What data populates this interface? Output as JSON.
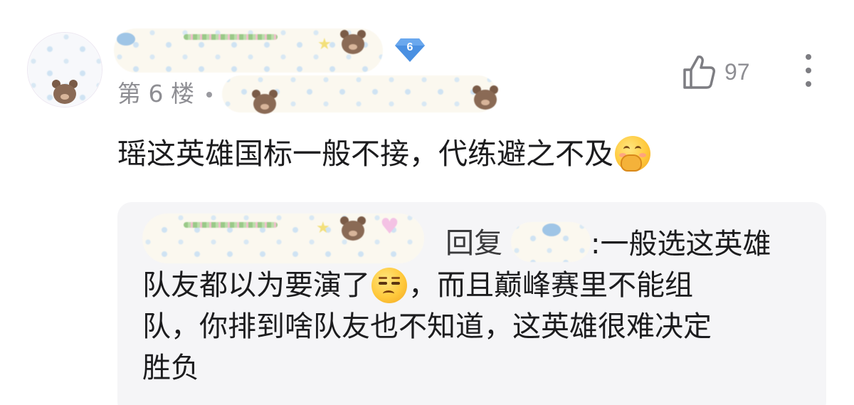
{
  "comment": {
    "floor_label": "第 6 楼",
    "separator": "•",
    "level": "6",
    "likes": "97",
    "text": "瑶这英雄国标一般不接，代练避之不及",
    "text_emoji": "hand-over-mouth-emoji"
  },
  "reply": {
    "reply_to_label": "回复",
    "colon_text": ":一般选这英雄",
    "line2_a": "队友都以为要演了",
    "line2_emoji": "unamused-face-emoji",
    "line2_b": "，而且巅峰赛里不能组",
    "line3": "队，你排到啥队友也不知道，这英雄很难决定",
    "line4": "胜负"
  },
  "colors": {
    "level_badge": "#4a90e2",
    "secondary_text": "#8e8e93",
    "reply_bg": "#f5f5f7"
  }
}
